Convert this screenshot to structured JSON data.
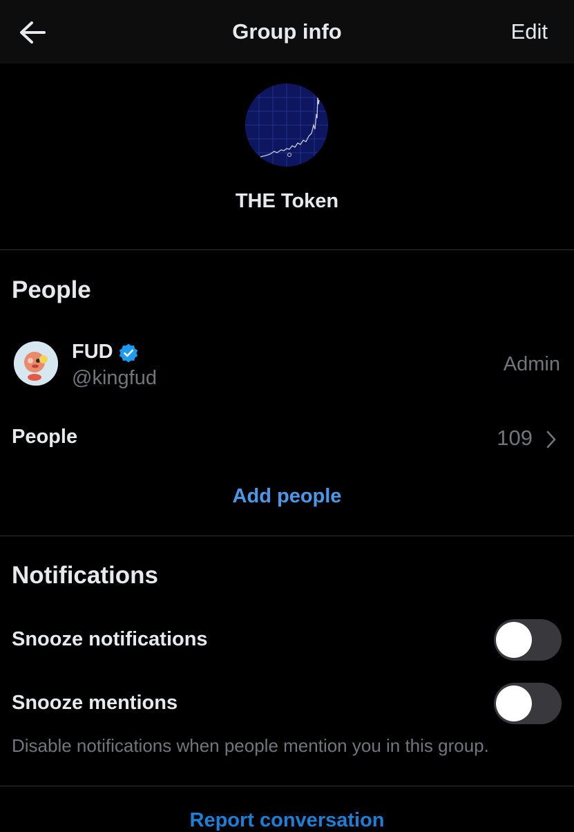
{
  "header": {
    "title": "Group info",
    "edit_label": "Edit"
  },
  "group": {
    "name": "THE Token",
    "avatar_icon": "price-chart-avatar"
  },
  "people_section": {
    "title": "People",
    "admin": {
      "name": "FUD",
      "handle": "@kingfud",
      "verified": true,
      "role": "Admin"
    },
    "people_row": {
      "label": "People",
      "count": "109"
    },
    "add_people_label": "Add people"
  },
  "notifications_section": {
    "title": "Notifications",
    "snooze_notifications": {
      "label": "Snooze notifications",
      "enabled": false
    },
    "snooze_mentions": {
      "label": "Snooze mentions",
      "enabled": false
    },
    "helper_text": "Disable notifications when people mention you in this group."
  },
  "report_label": "Report conversation",
  "colors": {
    "background": "#000000",
    "header_background": "#0d0d0d",
    "accent": "#4a99e9",
    "secondary_text": "#71767b",
    "verified_badge": "#1d9bf0",
    "toggle_off": "#39393d"
  }
}
